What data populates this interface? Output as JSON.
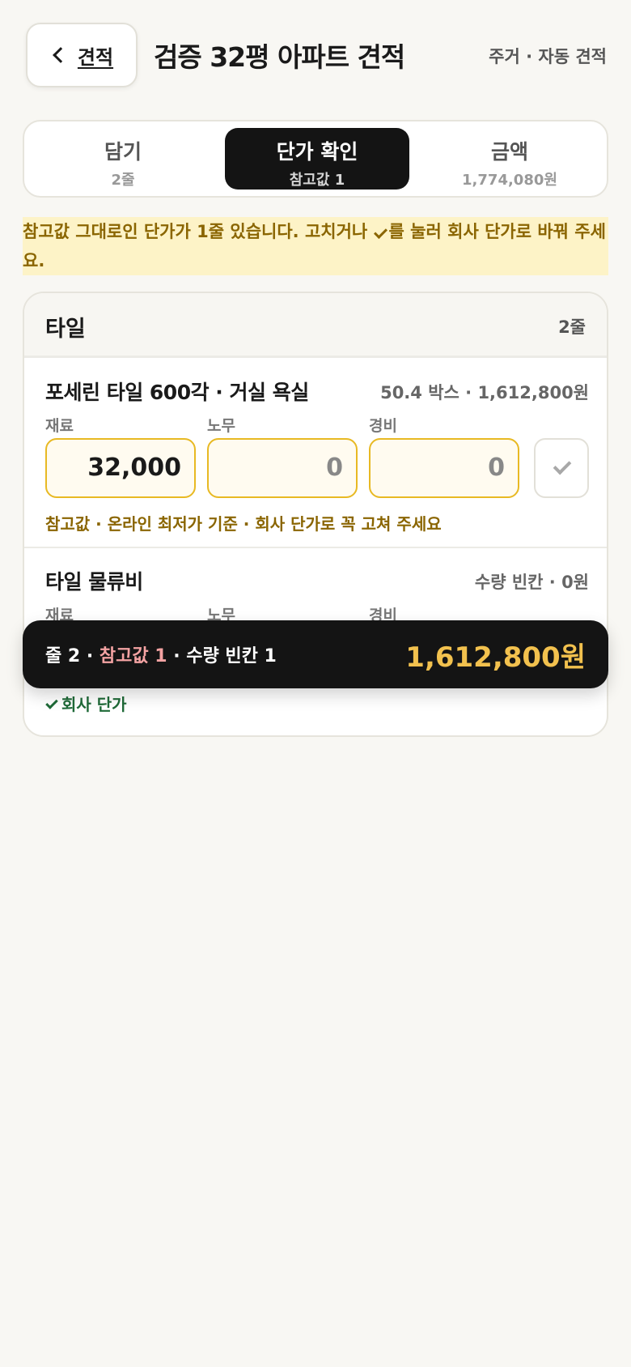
{
  "header": {
    "back_label": "견적",
    "title": "검증 32평 아파트 견적",
    "subtitle": "주거 · 자동 견적"
  },
  "tabs": [
    {
      "label": "담기",
      "sub": "2줄",
      "active": false
    },
    {
      "label": "단가 확인",
      "sub": "참고값 1",
      "active": true
    },
    {
      "label": "금액",
      "sub": "1,774,080원",
      "active": false
    }
  ],
  "notice": {
    "before": "참고값 그대로인 단가가 1줄 있습니다. 고치거나",
    "after": "를 눌러 회사 단가로 바꿔 주세요."
  },
  "section": {
    "name": "타일",
    "count": "2줄",
    "items": [
      {
        "name": "포세린 타일 600각 · 거실 욕실",
        "summary": "50.4 박스 · 1,612,800원",
        "labels": [
          "재료",
          "노무",
          "경비"
        ],
        "values": [
          "32,000",
          "0",
          "0"
        ],
        "hint": "참고값 · 온라인 최저가 기준 · 회사 단가로 꼭 고쳐 주세요"
      },
      {
        "name": "타일 물류비",
        "summary": "수량 빈칸 · 0원",
        "labels": [
          "재료",
          "노무",
          "경비"
        ],
        "status": "회사 단가"
      }
    ]
  },
  "summary_bar": {
    "lines": "줄 2 · ",
    "ref": "참고값 1",
    "blank": " · 수량 빈칸 1",
    "total": "1,612,800원"
  },
  "colors": {
    "background": "#f8f7f3",
    "accent_yellow": "#e8b923",
    "notice_bg": "#fdf3c7",
    "notice_text": "#8a6500",
    "dark": "#141414",
    "total": "#f2c14e",
    "ref_pink": "#f4a3a3",
    "verified_green": "#1f6a38"
  }
}
